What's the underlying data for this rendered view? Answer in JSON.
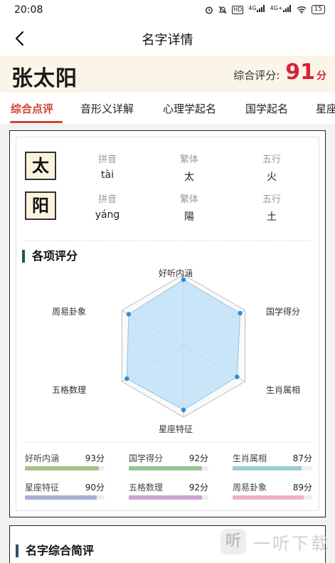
{
  "status_bar": {
    "time": "20:08",
    "signal1": "4G",
    "signal2": "4G+",
    "hd": "HD",
    "battery": "15"
  },
  "nav": {
    "title": "名字详情"
  },
  "header": {
    "name": "张太阳",
    "score_label": "综合评分:",
    "score": "91",
    "score_unit": "分"
  },
  "tabs": [
    {
      "label": "综合点评",
      "active": true
    },
    {
      "label": "音形义详解",
      "active": false
    },
    {
      "label": "心理学起名",
      "active": false
    },
    {
      "label": "国学起名",
      "active": false
    },
    {
      "label": "星座",
      "active": false
    }
  ],
  "characters": [
    {
      "char": "太",
      "pinyin_label": "拼音",
      "pinyin": "tài",
      "trad_label": "繁体",
      "trad": "太",
      "wuxing_label": "五行",
      "wuxing": "火"
    },
    {
      "char": "阳",
      "pinyin_label": "拼音",
      "pinyin": "yáng",
      "trad_label": "繁体",
      "trad": "陽",
      "wuxing_label": "五行",
      "wuxing": "土"
    }
  ],
  "ratings": {
    "title": "各项评分",
    "metrics": [
      {
        "name": "好听内涵",
        "value": "93分",
        "score": 93,
        "color": "#a6c48a"
      },
      {
        "name": "国学得分",
        "value": "92分",
        "score": 92,
        "color": "#97c496"
      },
      {
        "name": "生肖属相",
        "value": "87分",
        "score": 87,
        "color": "#98cdd1"
      },
      {
        "name": "星座特征",
        "value": "90分",
        "score": 90,
        "color": "#a7b0d8"
      },
      {
        "name": "五格数理",
        "value": "92分",
        "score": 92,
        "color": "#c9a7cf"
      },
      {
        "name": "周易卦象",
        "value": "89分",
        "score": 89,
        "color": "#f0b3c0"
      }
    ],
    "radar_fill": "#bfe0f7",
    "radar_point": "#2b8fd6"
  },
  "summary": {
    "title": "名字综合简评"
  },
  "watermark": {
    "logo": "听",
    "text": "一听下载"
  },
  "colors": {
    "accent": "#d1422f",
    "score": "#d6243a",
    "header_bg": "#fbf4e8"
  }
}
